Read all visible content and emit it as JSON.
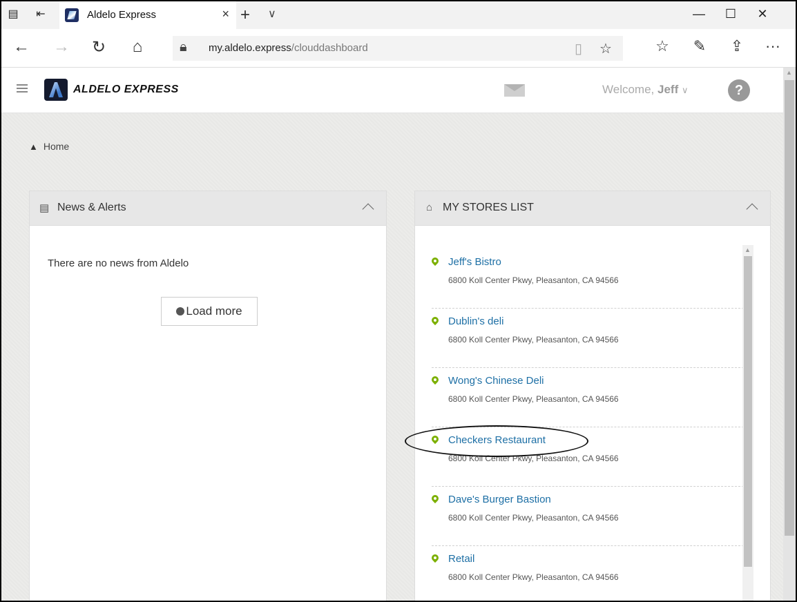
{
  "browser": {
    "tab_title": "Aldelo Express",
    "tab_close": "×",
    "new_tab": "+",
    "tab_list": "∨",
    "url_host": "my.aldelo.express",
    "url_path": "/clouddashboard",
    "win_min": "—",
    "win_max": "☐",
    "win_close": "✕",
    "more": "···"
  },
  "header": {
    "brand": "ALDELO EXPRESS",
    "welcome_prefix": "Welcome,",
    "welcome_user": "Jeff",
    "user_caret": "∨",
    "help": "?"
  },
  "breadcrumb": {
    "home": "Home"
  },
  "news": {
    "title": "News & Alerts",
    "empty_message": "There are no news from Aldelo",
    "load_more": "Load more"
  },
  "stores": {
    "title": "MY STORES LIST",
    "items": [
      {
        "name": "Jeff's Bistro",
        "address": "6800 Koll Center Pkwy, Pleasanton, CA 94566"
      },
      {
        "name": "Dublin's deli",
        "address": "6800 Koll Center Pkwy, Pleasanton, CA 94566"
      },
      {
        "name": "Wong's Chinese Deli",
        "address": "6800 Koll Center Pkwy, Pleasanton, CA 94566"
      },
      {
        "name": "Checkers Restaurant",
        "address": "6800 Koll Center Pkwy, Pleasanton, CA 94566"
      },
      {
        "name": "Dave's Burger Bastion",
        "address": "6800 Koll Center Pkwy, Pleasanton, CA 94566"
      },
      {
        "name": "Retail",
        "address": "6800 Koll Center Pkwy, Pleasanton, CA 94566"
      }
    ]
  },
  "colors": {
    "store_link": "#1d6fa5",
    "pin": "#7cb000"
  }
}
